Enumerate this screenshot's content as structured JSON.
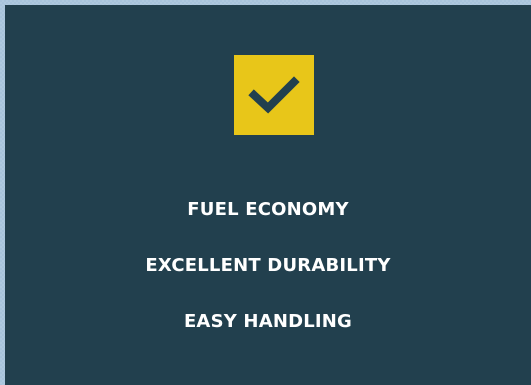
{
  "badge": {
    "icon": "checkmark-icon",
    "background_color": "#e8c619",
    "icon_color": "#22404e"
  },
  "card": {
    "background_color": "#22404e"
  },
  "features": [
    {
      "label": "FUEL ECONOMY"
    },
    {
      "label": "EXCELLENT DURABILITY"
    },
    {
      "label": "EASY HANDLING"
    }
  ]
}
